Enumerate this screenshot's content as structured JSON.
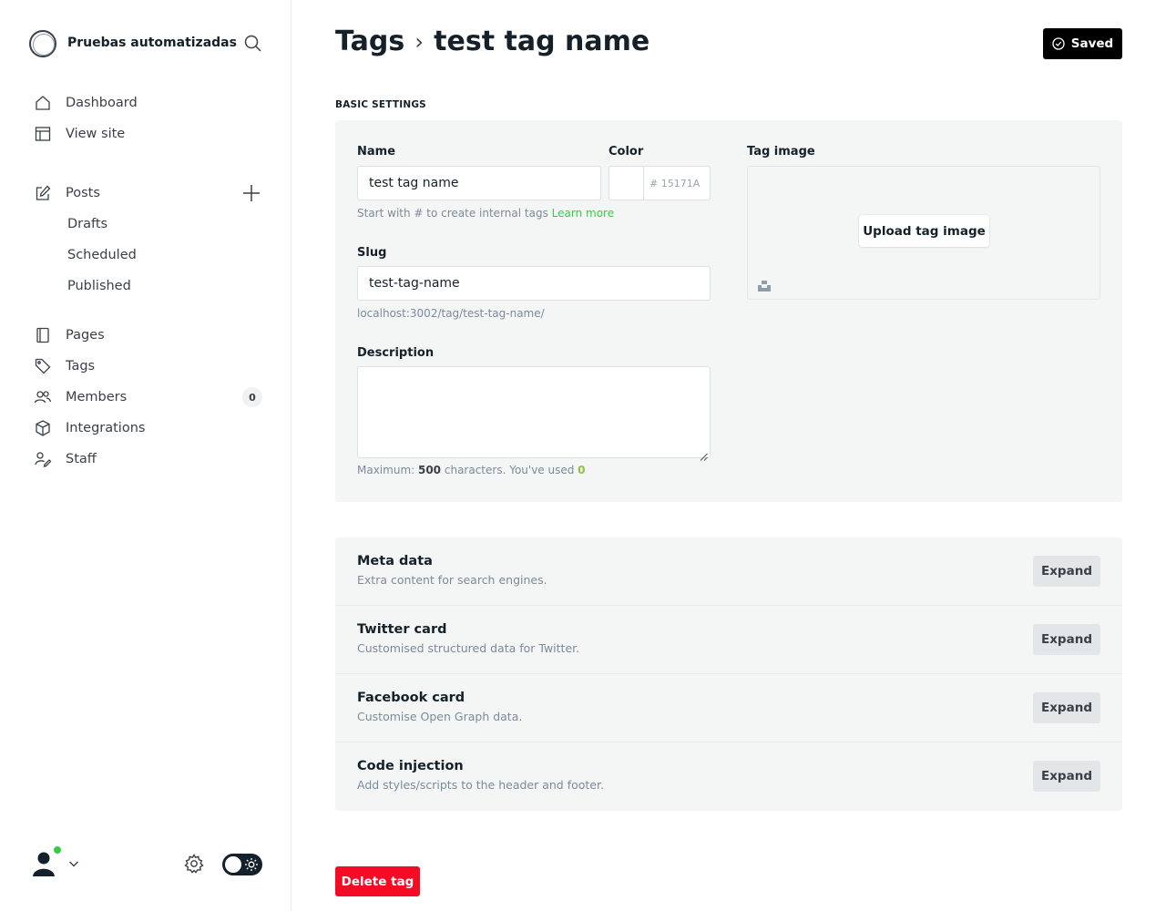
{
  "sidebar": {
    "site_title": "Pruebas automatizadas",
    "nav_primary": [
      {
        "label": "Dashboard",
        "icon": "home-icon"
      },
      {
        "label": "View site",
        "icon": "layout-icon"
      }
    ],
    "posts": {
      "label": "Posts",
      "icon": "edit-icon",
      "sub_items": [
        "Drafts",
        "Scheduled",
        "Published"
      ]
    },
    "nav_secondary": [
      {
        "label": "Pages",
        "icon": "page-icon"
      },
      {
        "label": "Tags",
        "icon": "tag-icon"
      },
      {
        "label": "Members",
        "icon": "members-icon",
        "badge": "0"
      },
      {
        "label": "Integrations",
        "icon": "cube-icon"
      },
      {
        "label": "Staff",
        "icon": "staff-icon"
      }
    ],
    "online_status_color": "#30cf43"
  },
  "header": {
    "breadcrumb_parent": "Tags",
    "breadcrumb_separator": "›",
    "title": "test tag name",
    "saved_label": "Saved"
  },
  "basic_settings": {
    "section_label": "BASIC SETTINGS",
    "name": {
      "label": "Name",
      "value": "test tag name",
      "hint_prefix": "Start with # to create internal tags",
      "hint_link": "Learn more"
    },
    "color": {
      "label": "Color",
      "placeholder": "# 15171A"
    },
    "slug": {
      "label": "Slug",
      "value": "test-tag-name",
      "url_preview": "localhost:3002/tag/test-tag-name/"
    },
    "description": {
      "label": "Description",
      "value": "",
      "hint_before": "Maximum: ",
      "max_chars": "500",
      "hint_middle": " characters. You've used ",
      "used_chars": "0"
    },
    "tag_image": {
      "label": "Tag image",
      "upload_label": "Upload tag image"
    }
  },
  "expand_sections": [
    {
      "title": "Meta data",
      "description": "Extra content for search engines.",
      "button": "Expand"
    },
    {
      "title": "Twitter card",
      "description": "Customised structured data for Twitter.",
      "button": "Expand"
    },
    {
      "title": "Facebook card",
      "description": "Customise Open Graph data.",
      "button": "Expand"
    },
    {
      "title": "Code injection",
      "description": "Add styles/scripts to the header and footer.",
      "button": "Expand"
    }
  ],
  "delete_label": "Delete tag",
  "colors": {
    "accent_green": "#30cf43",
    "danger_red": "#f50b23",
    "primary_dark": "#15212a"
  }
}
